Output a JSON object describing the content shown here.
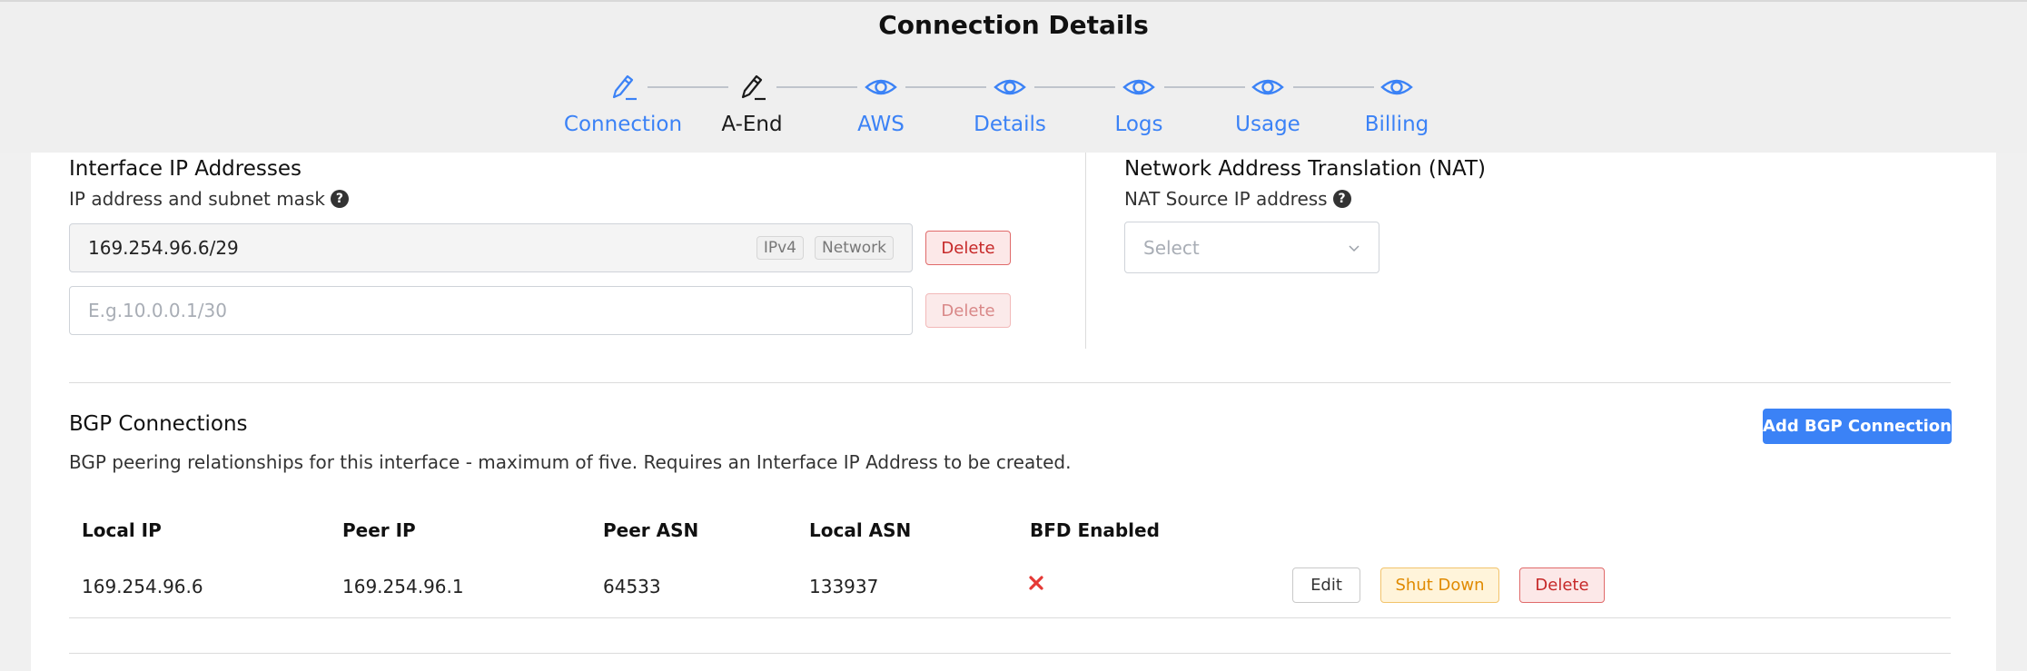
{
  "header": {
    "title": "Connection Details"
  },
  "steps": [
    {
      "label": "Connection",
      "icon": "pencil-icon",
      "active": false
    },
    {
      "label": "A-End",
      "icon": "pencil-icon",
      "active": true
    },
    {
      "label": "AWS",
      "icon": "eye-icon",
      "active": false
    },
    {
      "label": "Details",
      "icon": "eye-icon",
      "active": false
    },
    {
      "label": "Logs",
      "icon": "eye-icon",
      "active": false
    },
    {
      "label": "Usage",
      "icon": "eye-icon",
      "active": false
    },
    {
      "label": "Billing",
      "icon": "eye-icon",
      "active": false
    }
  ],
  "interface_ips": {
    "title": "Interface IP Addresses",
    "subtitle": "IP address and subnet mask",
    "entries": [
      {
        "value": "169.254.96.6/29",
        "tags": [
          "IPv4",
          "Network"
        ],
        "delete_label": "Delete"
      },
      {
        "value": "",
        "placeholder": "E.g.10.0.0.1/30",
        "delete_label": "Delete"
      }
    ]
  },
  "nat": {
    "title": "Network Address Translation (NAT)",
    "subtitle": "NAT Source IP address",
    "select_placeholder": "Select"
  },
  "bgp": {
    "title": "BGP Connections",
    "add_button": "Add BGP Connection",
    "description": "BGP peering relationships for this interface - maximum of five. Requires an Interface IP Address to be created.",
    "columns": [
      "Local IP",
      "Peer IP",
      "Peer ASN",
      "Local ASN",
      "BFD Enabled"
    ],
    "rows": [
      {
        "local_ip": "169.254.96.6",
        "peer_ip": "169.254.96.1",
        "peer_asn": "64533",
        "local_asn": "133937",
        "bfd_enabled": false,
        "actions": {
          "edit": "Edit",
          "shutdown": "Shut Down",
          "delete": "Delete"
        }
      }
    ]
  },
  "colors": {
    "accent": "#3b82f6",
    "danger": "#c62828",
    "warning": "#e08a00"
  }
}
